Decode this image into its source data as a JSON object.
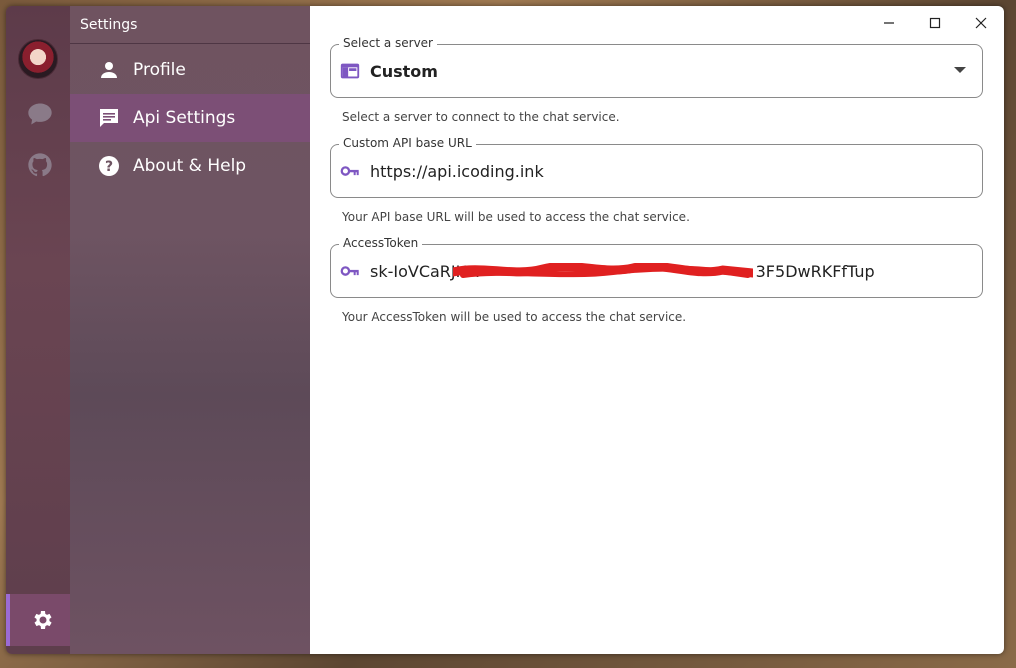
{
  "rail": {
    "avatar": "user-avatar",
    "icons": [
      "chat-icon",
      "github-icon",
      "gear-icon"
    ]
  },
  "nav": {
    "title": "Settings",
    "items": [
      {
        "label": "Profile",
        "icon": "person-icon",
        "active": false
      },
      {
        "label": "Api Settings",
        "icon": "message-icon",
        "active": true
      },
      {
        "label": "About & Help",
        "icon": "help-icon",
        "active": false
      }
    ]
  },
  "server": {
    "label": "Select a server",
    "value": "Custom",
    "helper": "Select a server to connect to the chat service."
  },
  "base_url": {
    "label": "Custom API base URL",
    "value": "https://api.icoding.ink",
    "helper": "Your API base URL will be used to access the chat service."
  },
  "token": {
    "label": "AccessToken",
    "value_prefix": "sk-IoVCaRJHA",
    "value_suffix": "3F5DwRKFfTup",
    "helper": "Your AccessToken will be used to access the chat service."
  },
  "colors": {
    "accent": "#7e57c2",
    "nav_active": "#7c4f76",
    "redaction": "#e02020"
  }
}
